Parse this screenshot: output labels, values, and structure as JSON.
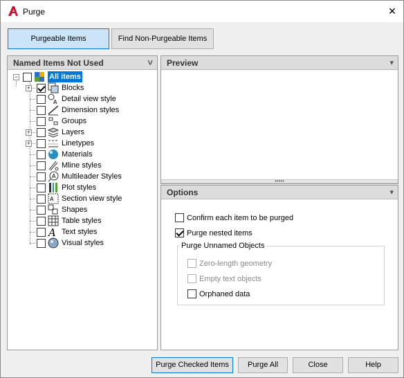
{
  "window": {
    "title": "Purge",
    "close_glyph": "✕"
  },
  "tabs": [
    {
      "label": "Purgeable Items",
      "active": true
    },
    {
      "label": "Find Non-Purgeable Items",
      "active": false
    }
  ],
  "left_panel": {
    "title": "Named Items Not Used",
    "collapse_glyph": "˅",
    "root": {
      "label": "All items",
      "checked": false,
      "expander": "−"
    },
    "items": [
      {
        "label": "Blocks",
        "checked": true,
        "expandable": true,
        "icon": "blocks-icon"
      },
      {
        "label": "Detail view style",
        "checked": false,
        "expandable": false,
        "icon": "detail-view-icon"
      },
      {
        "label": "Dimension styles",
        "checked": false,
        "expandable": false,
        "icon": "dimension-icon"
      },
      {
        "label": "Groups",
        "checked": false,
        "expandable": false,
        "icon": "groups-icon"
      },
      {
        "label": "Layers",
        "checked": false,
        "expandable": true,
        "icon": "layers-icon"
      },
      {
        "label": "Linetypes",
        "checked": false,
        "expandable": true,
        "icon": "linetypes-icon"
      },
      {
        "label": "Materials",
        "checked": false,
        "expandable": false,
        "icon": "materials-icon"
      },
      {
        "label": "Mline styles",
        "checked": false,
        "expandable": false,
        "icon": "mline-icon"
      },
      {
        "label": "Multileader Styles",
        "checked": false,
        "expandable": false,
        "icon": "multileader-icon"
      },
      {
        "label": "Plot styles",
        "checked": false,
        "expandable": false,
        "icon": "plot-styles-icon"
      },
      {
        "label": "Section view style",
        "checked": false,
        "expandable": false,
        "icon": "section-view-icon"
      },
      {
        "label": "Shapes",
        "checked": false,
        "expandable": false,
        "icon": "shapes-icon"
      },
      {
        "label": "Table styles",
        "checked": false,
        "expandable": false,
        "icon": "table-styles-icon"
      },
      {
        "label": "Text styles",
        "checked": false,
        "expandable": false,
        "icon": "text-styles-icon"
      },
      {
        "label": "Visual styles",
        "checked": false,
        "expandable": false,
        "icon": "visual-styles-icon"
      }
    ]
  },
  "preview_panel": {
    "title": "Preview",
    "collapse_glyph": "▾",
    "splitter_glyph": "•••••"
  },
  "options_panel": {
    "title": "Options",
    "collapse_glyph": "▾",
    "confirm": {
      "label": "Confirm each item to be purged",
      "checked": false
    },
    "nested": {
      "label": "Purge nested items",
      "checked": true
    },
    "unnamed_group": {
      "title": "Purge Unnamed Objects",
      "zero_length": {
        "label": "Zero-length geometry",
        "checked": false,
        "enabled": false
      },
      "empty_text": {
        "label": "Empty text objects",
        "checked": false,
        "enabled": false
      },
      "orphaned": {
        "label": "Orphaned data",
        "checked": false,
        "enabled": true
      }
    }
  },
  "buttons": {
    "purge_checked": "Purge Checked Items",
    "purge_all": "Purge All",
    "close": "Close",
    "help": "Help"
  },
  "colors": {
    "accent": "#0078d7",
    "brand": "#c8102e"
  }
}
